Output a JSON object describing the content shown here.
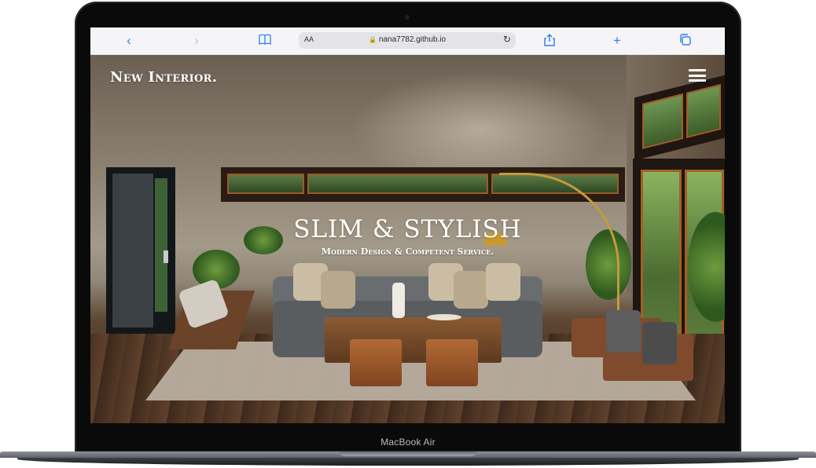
{
  "device": {
    "label": "MacBook Air"
  },
  "browser": {
    "url": "nana7782.github.io",
    "text_size_label": "AA",
    "icons": {
      "back": "chevron-left-icon",
      "forward": "chevron-right-icon",
      "bookmarks": "book-icon",
      "lock": "lock-icon",
      "reload": "reload-icon",
      "share": "share-icon",
      "new_tab": "plus-icon",
      "tabs": "tabs-icon"
    },
    "accent_color": "#2f7cf6"
  },
  "site": {
    "logo": "New Interior.",
    "menu_icon": "hamburger-menu-icon",
    "hero": {
      "title": "SLIM & STYLISH",
      "subtitle": "Modern Design & Competent Service."
    }
  }
}
